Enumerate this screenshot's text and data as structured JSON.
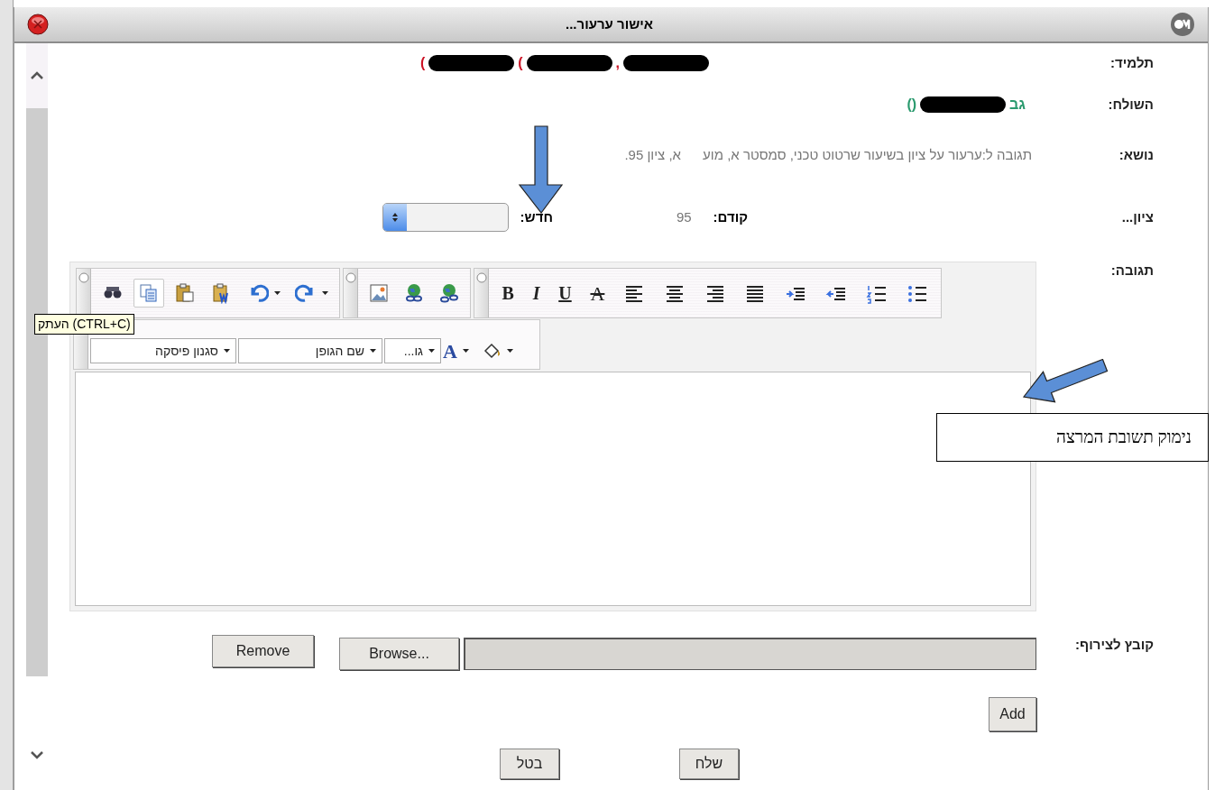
{
  "window": {
    "title": "אישור ערעור..."
  },
  "student": {
    "label": "תלמיד:",
    "parts": [
      {
        "kind": "redacted"
      },
      {
        "kind": "text",
        "text": ","
      },
      {
        "kind": "redacted"
      },
      {
        "kind": "text",
        "text": "("
      },
      {
        "kind": "redacted"
      },
      {
        "kind": "text",
        "text": "("
      }
    ]
  },
  "sender": {
    "label": "השולח:",
    "parts": [
      {
        "kind": "text",
        "text": "גב"
      },
      {
        "kind": "redacted"
      },
      {
        "kind": "text",
        "text": "()"
      }
    ]
  },
  "subject": {
    "label": "נושא:",
    "parts": [
      "תגובה ל:ערעור על ציון בשיעור שרטוט טכני, סמסטר א, מוע",
      "א, ציון 95."
    ]
  },
  "grade": {
    "label": "ציון...",
    "previous_label": "קודם:",
    "previous_value": "95",
    "new_label": "חדש:"
  },
  "response": {
    "label": "תגובה:",
    "toolbar_groups": [
      [
        {
          "kind": "bullet_list",
          "hovered": false,
          "has_dropdown": false
        },
        {
          "kind": "ordered_list",
          "hovered": false,
          "has_dropdown": false
        },
        {
          "kind": "outdent",
          "hovered": false,
          "has_dropdown": false
        },
        {
          "kind": "indent",
          "hovered": false,
          "has_dropdown": false
        },
        {
          "kind": "justify",
          "hovered": false,
          "has_dropdown": false
        },
        {
          "kind": "align_right",
          "hovered": false,
          "has_dropdown": false
        },
        {
          "kind": "align_center",
          "hovered": false,
          "has_dropdown": false
        },
        {
          "kind": "align_left",
          "hovered": false,
          "has_dropdown": false
        },
        {
          "kind": "strike",
          "text": "A",
          "hovered": false,
          "has_dropdown": false
        },
        {
          "kind": "underline",
          "text": "U",
          "hovered": false,
          "has_dropdown": false
        },
        {
          "kind": "italic",
          "text": "I",
          "hovered": false,
          "has_dropdown": false
        },
        {
          "kind": "bold",
          "text": "B",
          "hovered": false,
          "has_dropdown": false
        }
      ],
      [
        {
          "kind": "unlink",
          "hovered": false,
          "has_dropdown": false
        },
        {
          "kind": "link",
          "hovered": false,
          "has_dropdown": false
        },
        {
          "kind": "image",
          "hovered": false,
          "has_dropdown": false
        }
      ],
      [
        {
          "kind": "redo",
          "hovered": false,
          "has_dropdown": true
        },
        {
          "kind": "undo",
          "hovered": false,
          "has_dropdown": true
        },
        {
          "kind": "paste_word",
          "hovered": false,
          "has_dropdown": false
        },
        {
          "kind": "paste",
          "hovered": false,
          "has_dropdown": false
        },
        {
          "kind": "copy",
          "hovered": true,
          "has_dropdown": false
        },
        {
          "kind": "find",
          "hovered": false,
          "has_dropdown": false
        }
      ]
    ],
    "format_bar": [
      {
        "kind": "highlight"
      },
      {
        "kind": "font_color",
        "text": "A"
      },
      {
        "kind": "dropdown",
        "text": "גו..."
      },
      {
        "kind": "dropdown",
        "text": "שם הגופן"
      },
      {
        "kind": "dropdown",
        "text": "סגנון פיסקה"
      }
    ],
    "tooltip": "העתק (CTRL+C)"
  },
  "attachment": {
    "label": "קובץ לצירוף:",
    "browse": "Browse...",
    "remove": "Remove",
    "add": "Add"
  },
  "actions": [
    "שלח",
    "בטל"
  ],
  "annotation": {
    "callout": "נימוק תשובת המרצה"
  }
}
